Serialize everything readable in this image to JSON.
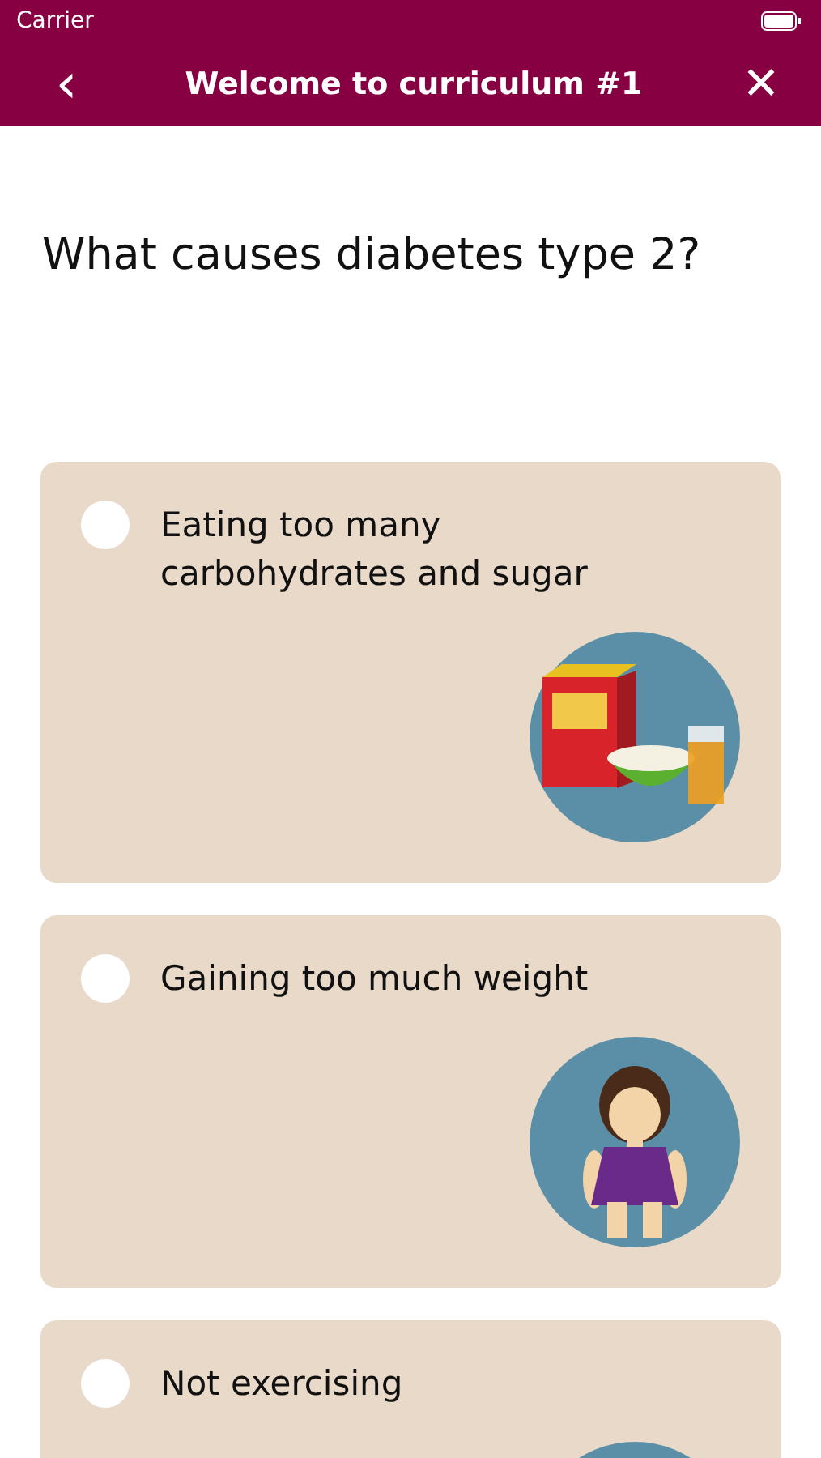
{
  "status_bar": {
    "carrier": "Carrier"
  },
  "header": {
    "back": "‹",
    "title": "Welcome to curriculum #1",
    "close": "✕"
  },
  "question": "What causes diabetes type 2?",
  "answers": [
    {
      "label": "Eating too many carbohydrates and sugar",
      "selected": false,
      "kind": "picture"
    },
    {
      "label": "Gaining too much weight",
      "selected": false,
      "kind": "picture"
    },
    {
      "label": "Not exercising",
      "selected": false,
      "kind": "picture"
    }
  ]
}
